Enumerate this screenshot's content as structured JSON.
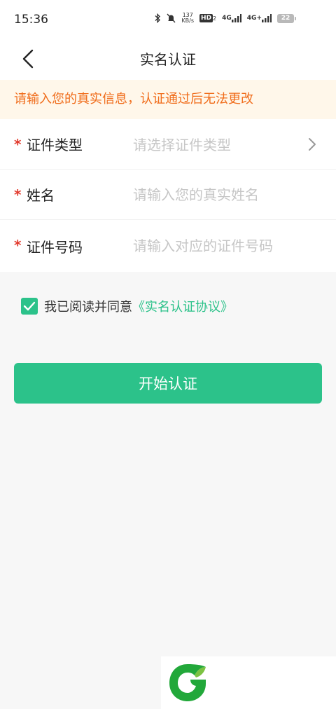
{
  "status_bar": {
    "time": "15:36",
    "net_speed_value": "137",
    "net_speed_unit": "KB/s",
    "hd_label": "HD",
    "hd_sub": "2",
    "signal1_label": "4G",
    "signal2_label": "4G+",
    "battery_level": "22",
    "icons": [
      "bluetooth-icon",
      "mute-icon",
      "signal-icon",
      "battery-icon"
    ]
  },
  "nav": {
    "title": "实名认证",
    "back_icon": "chevron-left-icon"
  },
  "notice": {
    "text": "请输入您的真实信息，认证通过后无法更改",
    "color": "#f06c1a",
    "background": "#fff7ea"
  },
  "form": {
    "required_mark": "*",
    "rows": [
      {
        "label": "证件类型",
        "placeholder": "请选择证件类型",
        "type": "select"
      },
      {
        "label": "姓名",
        "placeholder": "请输入您的真实姓名",
        "type": "input"
      },
      {
        "label": "证件号码",
        "placeholder": "请输入对应的证件号码",
        "type": "input"
      }
    ]
  },
  "agreement": {
    "checked": true,
    "prefix": "我已阅读并同意",
    "link": "《实名认证协议》"
  },
  "submit": {
    "label": "开始认证"
  },
  "colors": {
    "accent": "#2cc28a",
    "required": "#e23b2e",
    "page_background": "#f7f7f7"
  }
}
